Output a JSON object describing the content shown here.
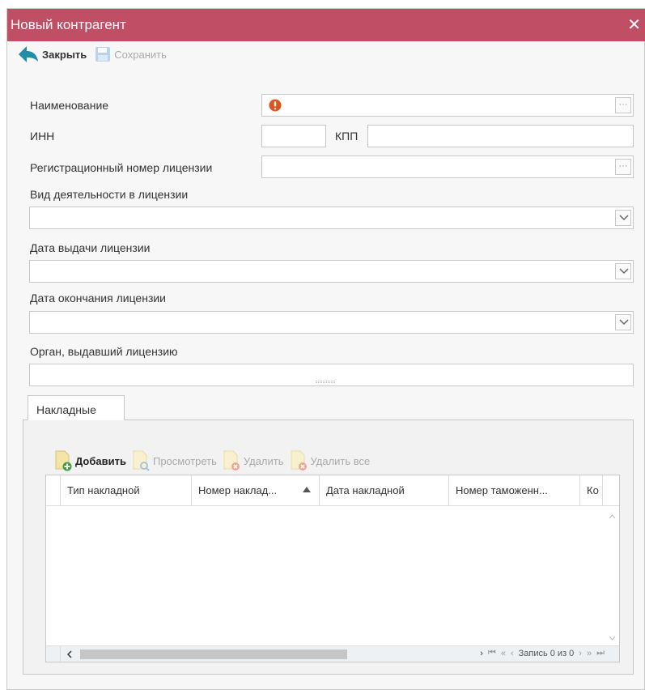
{
  "window": {
    "title": "Новый контрагент",
    "close_glyph": "✕"
  },
  "toolbar": {
    "close_label": "Закрыть",
    "save_label": "Сохранить"
  },
  "form": {
    "name_label": "Наименование",
    "inn_label": "ИНН",
    "kpp_label": "КПП",
    "reg_license_label": "Регистрационный номер лицензии",
    "activity_label": "Вид деятельности в лицензии",
    "issue_date_label": "Дата выдачи лицензии",
    "expiry_date_label": "Дата окончания лицензии",
    "issuer_label": "Орган, выдавший лицензию",
    "name_value": "",
    "inn_value": "",
    "kpp_value": "",
    "reg_license_value": "",
    "activity_value": "",
    "issue_date_value": "",
    "expiry_date_value": "",
    "issuer_value": "",
    "ellipsis": "···"
  },
  "tabs": [
    {
      "label": "Накладные"
    }
  ],
  "grid_toolbar": {
    "add": "Добавить",
    "view": "Просмотреть",
    "delete": "Удалить",
    "delete_all": "Удалить все"
  },
  "grid": {
    "columns": [
      "Тип накладной",
      "Номер наклад...",
      "Дата накладной",
      "Номер таможенн...",
      "Ко"
    ],
    "rows": [],
    "pager_text": "Запись 0 из 0"
  },
  "colors": {
    "titlebar": "#c04f66",
    "warning": "#e0531f"
  }
}
